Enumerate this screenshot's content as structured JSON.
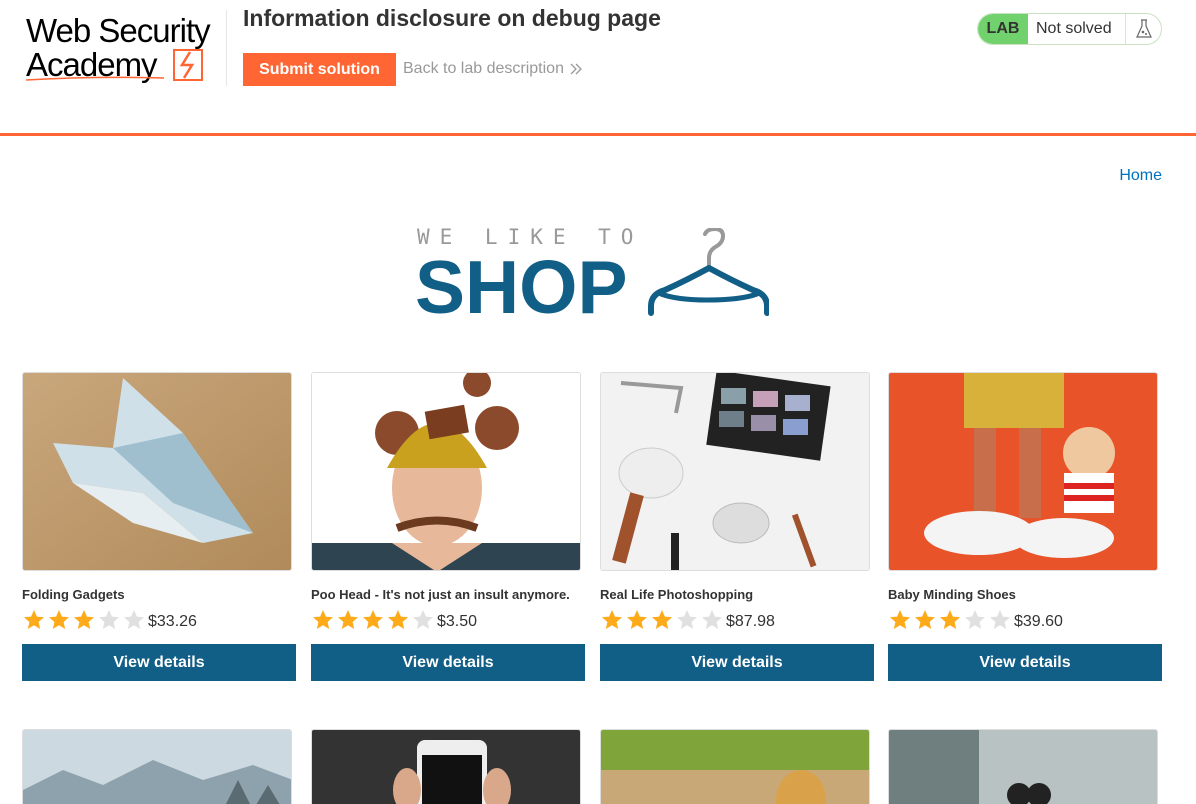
{
  "header": {
    "logo_text_line1": "Web Security",
    "logo_text_line2": "Academy",
    "lab_title": "Information disclosure on debug page",
    "submit_label": "Submit solution",
    "back_label": "Back to lab description",
    "lab_badge": "LAB",
    "lab_status": "Not solved"
  },
  "nav": {
    "home_label": "Home"
  },
  "banner": {
    "small_text": "WE LIKE TO",
    "big_text": "SHOP"
  },
  "products": [
    {
      "name": "Folding Gadgets",
      "rating": 3,
      "price": "$33.26",
      "button": "View details"
    },
    {
      "name": "Poo Head - It's not just an insult anymore.",
      "rating": 4,
      "price": "$3.50",
      "button": "View details"
    },
    {
      "name": "Real Life Photoshopping",
      "rating": 3,
      "price": "$87.98",
      "button": "View details"
    },
    {
      "name": "Baby Minding Shoes",
      "rating": 3,
      "price": "$39.60",
      "button": "View details"
    }
  ],
  "colors": {
    "accent": "#ff6633",
    "primary": "#115e86",
    "star_on": "#fdab1a",
    "star_off": "#e0e0e0",
    "lab_green": "#70d16d"
  }
}
